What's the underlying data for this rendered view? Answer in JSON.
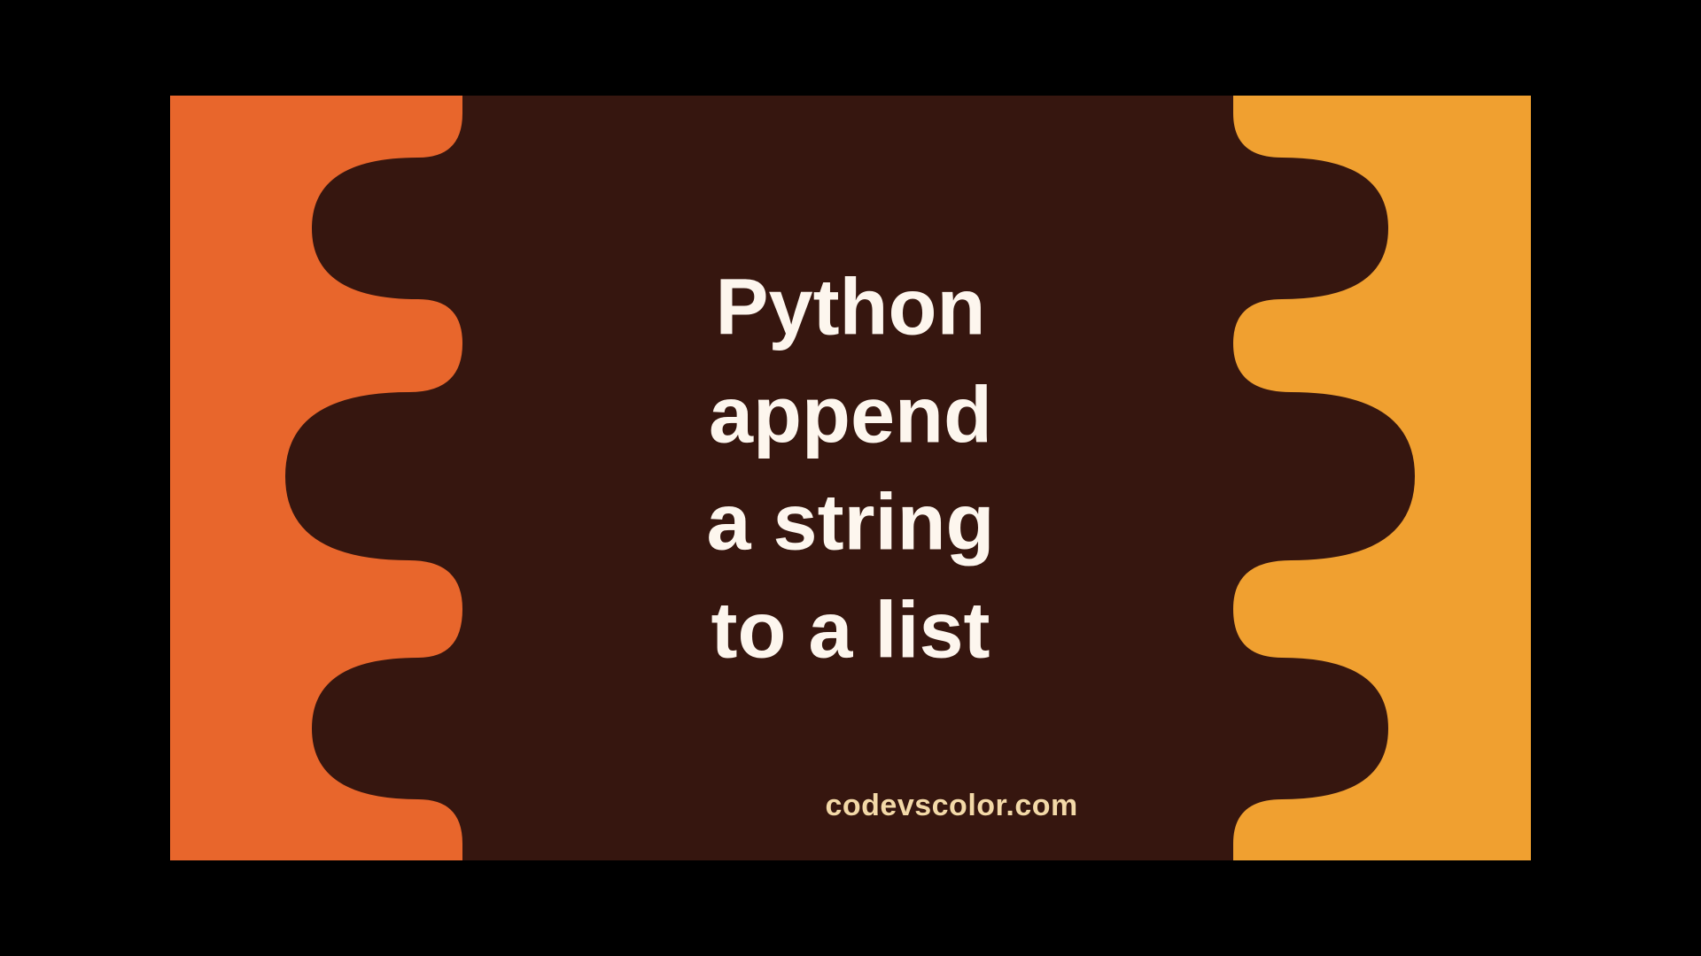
{
  "title": "Python\nappend\na string\nto a list",
  "footer": "codevscolor.com",
  "colors": {
    "bg_left": "#e8662c",
    "bg_right": "#f0a030",
    "blob": "#36160f",
    "text_main": "#fdf6ee",
    "text_footer": "#f3d9a8"
  }
}
